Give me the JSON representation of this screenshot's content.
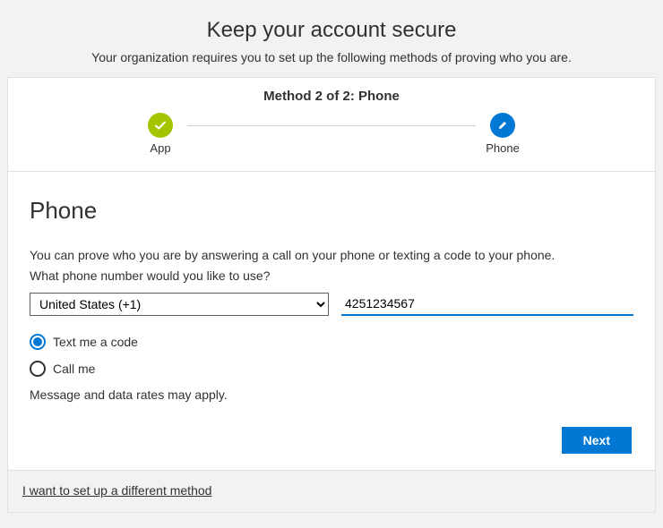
{
  "header": {
    "title": "Keep your account secure",
    "subtitle": "Your organization requires you to set up the following methods of proving who you are."
  },
  "progress": {
    "label": "Method 2 of 2: Phone",
    "steps": {
      "app": "App",
      "phone": "Phone"
    }
  },
  "form": {
    "heading": "Phone",
    "description_line1": "You can prove who you are by answering a call on your phone or texting a code to your phone.",
    "description_line2": "What phone number would you like to use?",
    "country_value": "United States (+1)",
    "phone_value": "4251234567",
    "radio_text": "Text me a code",
    "radio_call": "Call me",
    "rates_notice": "Message and data rates may apply.",
    "next_button": "Next"
  },
  "footer": {
    "different_method_link": "I want to set up a different method"
  }
}
